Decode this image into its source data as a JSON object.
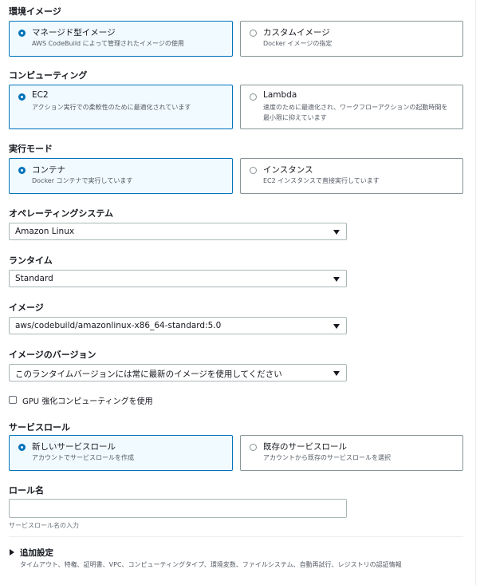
{
  "environment_image": {
    "label": "環境イメージ",
    "options": [
      {
        "title": "マネージド型イメージ",
        "desc": "AWS CodeBuild によって管理されたイメージの使用",
        "selected": true
      },
      {
        "title": "カスタムイメージ",
        "desc": "Docker イメージの指定",
        "selected": false
      }
    ]
  },
  "computing": {
    "label": "コンピューティング",
    "options": [
      {
        "title": "EC2",
        "desc": "アクション実行での柔軟性のために最適化されています",
        "selected": true
      },
      {
        "title": "Lambda",
        "desc": "速度のために最適化され、ワークフローアクションの起動時間を最小限に抑えています",
        "selected": false
      }
    ]
  },
  "run_mode": {
    "label": "実行モード",
    "options": [
      {
        "title": "コンテナ",
        "desc": "Docker コンテナで実行しています",
        "selected": true
      },
      {
        "title": "インスタンス",
        "desc": "EC2 インスタンスで直接実行しています",
        "selected": false
      }
    ]
  },
  "os": {
    "label": "オペレーティングシステム",
    "value": "Amazon Linux"
  },
  "runtime": {
    "label": "ランタイム",
    "value": "Standard"
  },
  "image": {
    "label": "イメージ",
    "value": "aws/codebuild/amazonlinux-x86_64-standard:5.0"
  },
  "image_version": {
    "label": "イメージのバージョン",
    "value": "このランタイムバージョンには常に最新のイメージを使用してください"
  },
  "gpu": {
    "label": "GPU 強化コンピューティングを使用",
    "checked": false
  },
  "service_role": {
    "label": "サービスロール",
    "options": [
      {
        "title": "新しいサービスロール",
        "desc": "アカウントでサービスロールを作成",
        "selected": true
      },
      {
        "title": "既存のサービスロール",
        "desc": "アカウントから既存のサービスロールを選択",
        "selected": false
      }
    ]
  },
  "role_name": {
    "label": "ロール名",
    "value": "",
    "hint": "サービスロール名の入力"
  },
  "advanced": {
    "title": "追加設定",
    "desc": "タイムアウト、特権、証明書、VPC、コンピューティングタイプ、環境変数、ファイルシステム、自動再試行、レジストリの認証情報"
  }
}
